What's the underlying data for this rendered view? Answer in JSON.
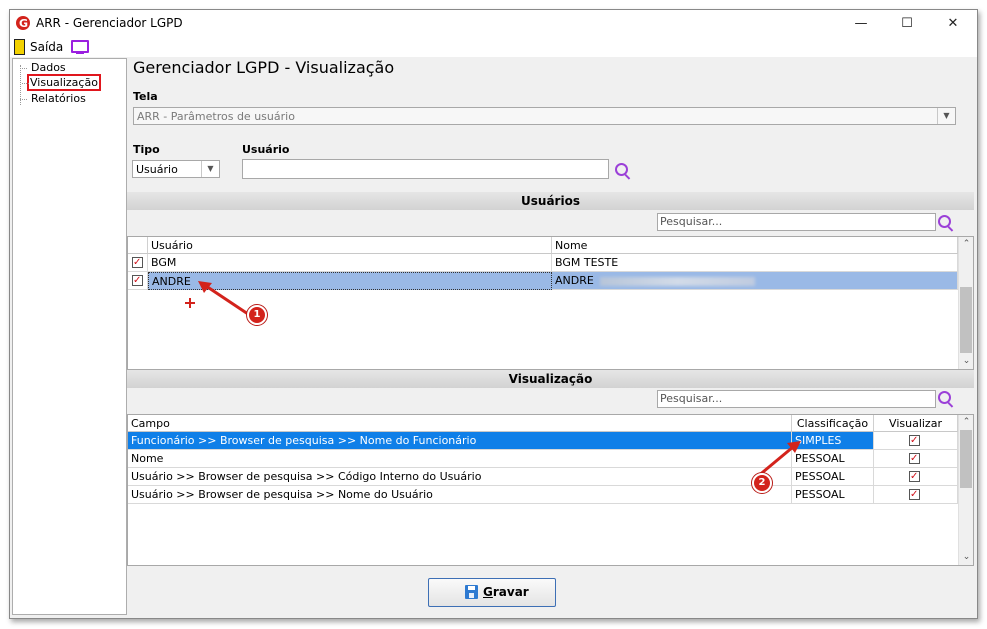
{
  "window": {
    "title": "ARR - Gerenciador LGPD",
    "minimize": "—",
    "maximize": "☐",
    "close": "✕"
  },
  "toolbar": {
    "exit_label": "Saída"
  },
  "sidebar": {
    "items": [
      {
        "label": "Dados"
      },
      {
        "label": "Visualização"
      },
      {
        "label": "Relatórios"
      }
    ]
  },
  "main": {
    "title": "Gerenciador LGPD - Visualização",
    "tela_label": "Tela",
    "tela_value": "ARR - Parâmetros de usuário",
    "tipo_label": "Tipo",
    "tipo_value": "Usuário",
    "usuario_label": "Usuário",
    "usuario_value": ""
  },
  "usuarios": {
    "header": "Usuários",
    "search_placeholder": "Pesquisar...",
    "columns": [
      "Usuário",
      "Nome"
    ],
    "rows": [
      {
        "usuario": "BGM",
        "nome": "BGM TESTE",
        "checked": true
      },
      {
        "usuario": "ANDRE",
        "nome": "ANDRE",
        "checked": true
      }
    ]
  },
  "visualizacao": {
    "header": "Visualização",
    "search_placeholder": "Pesquisar...",
    "columns": [
      "Campo",
      "Classificação",
      "Visualizar"
    ],
    "rows": [
      {
        "campo": "Funcionário >> Browser de pesquisa >> Nome do Funcionário",
        "classificacao": "SIMPLES",
        "visualizar": true
      },
      {
        "campo": "Nome",
        "classificacao": "PESSOAL",
        "visualizar": true
      },
      {
        "campo": "Usuário >> Browser de pesquisa >> Código Interno do Usuário",
        "classificacao": "PESSOAL",
        "visualizar": true
      },
      {
        "campo": "Usuário >> Browser de pesquisa >> Nome do Usuário",
        "classificacao": "PESSOAL",
        "visualizar": true
      }
    ]
  },
  "annotations": {
    "badge1": "1",
    "badge2": "2"
  },
  "footer": {
    "save_label": "Gravar"
  },
  "colors": {
    "selected_row": "#9ab9e6",
    "active_row": "#0f7fe8",
    "annotation_red": "#d3231c",
    "icon_purple": "#9b40d8"
  }
}
